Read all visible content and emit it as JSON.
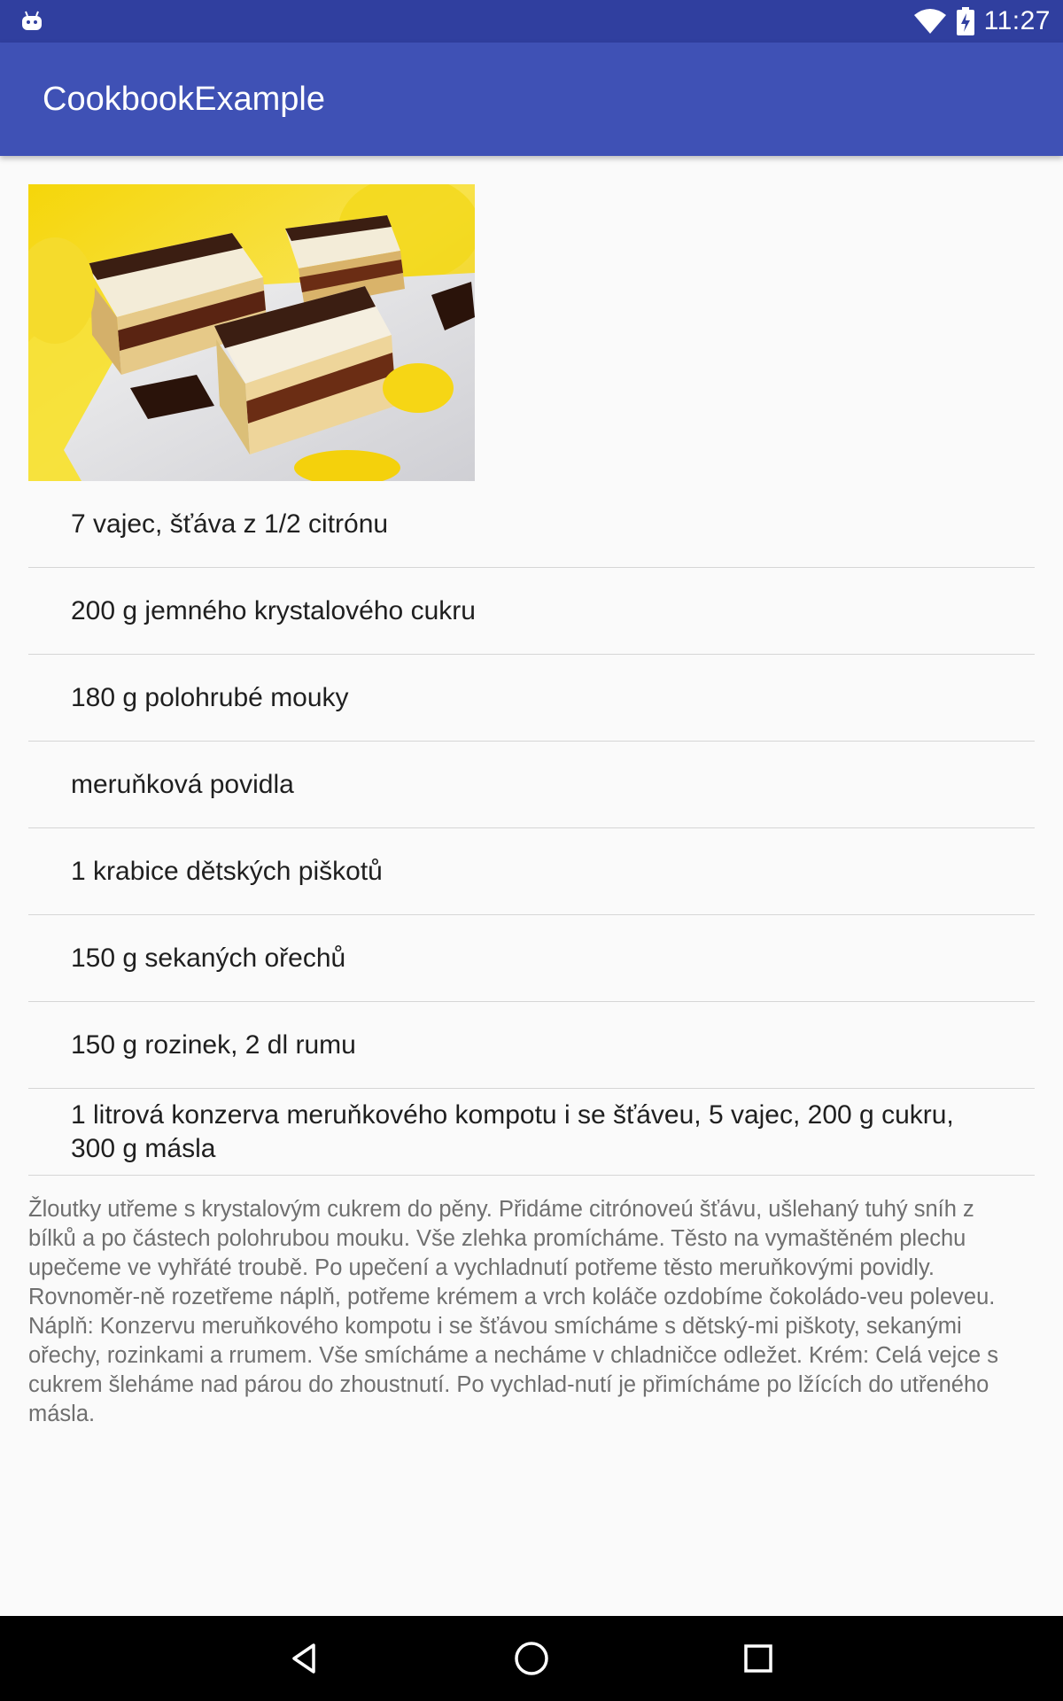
{
  "status_bar": {
    "time": "11:27"
  },
  "app_bar": {
    "title": "CookbookExample"
  },
  "recipe": {
    "image_description": "cake-slices-photo",
    "ingredients": [
      "7 vajec, šťáva z 1/2 citrónu",
      "200 g jemného krystalového cukru",
      "180 g polohrubé mouky",
      "meruňková povidla",
      "1 krabice dětských piškotů",
      "150 g sekaných ořechů",
      "150 g rozinek, 2 dl rumu",
      "1 litrová konzerva meruňkového kompotu i se šťáveu, 5 vajec, 200 g cukru, 300 g másla"
    ],
    "instructions": "Žloutky utřeme s krystalovým cukrem do pěny. Přidáme citrónoveú šťávu, ušlehaný tuhý sníh z bílků a po částech polohrubou mouku. Vše zlehka promícháme. Těsto na vymaštěném plechu  upečeme ve vyhřáté troubě. Po upečení a vychladnutí potřeme těsto meruňkovými povidly. Rovnoměr-ně rozetřeme náplň, potřeme krémem a vrch koláče ozdobíme čokoládo-veu poleveu. Náplň: Konzervu meruňkového kompotu i se šťávou smícháme s dětský-mi piškoty, sekanými ořechy, rozinkami a rrumem. Vše smícháme a necháme v chladničce odležet. Krém: Celá vejce s cukrem šleháme nad párou do zhoustnutí. Po vychlad-nutí  je přimícháme po lžících do utřeného másla."
  },
  "colors": {
    "status_bar": "#303f9f",
    "app_bar": "#3f51b5",
    "background": "#fafafa",
    "divider": "#d6d6d6"
  },
  "icons": {
    "status_left": "android-notification-icon",
    "wifi": "wifi-icon",
    "battery": "battery-charging-icon",
    "nav_back": "back-triangle-icon",
    "nav_home": "home-circle-icon",
    "nav_recents": "recents-square-icon"
  }
}
